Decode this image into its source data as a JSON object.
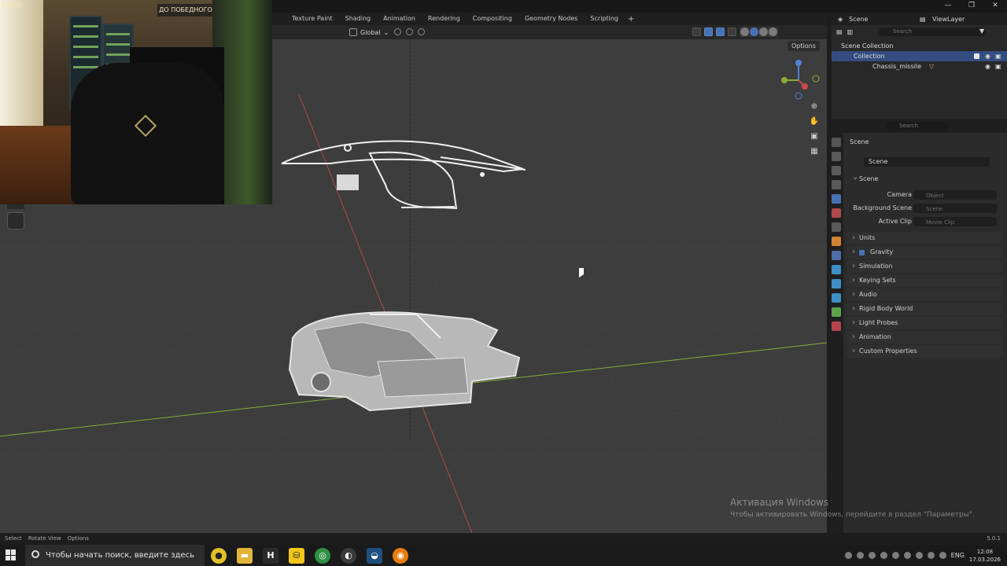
{
  "window": {
    "controls": [
      "—",
      "❐",
      "✕"
    ]
  },
  "workspace_tabs": [
    "Texture Paint",
    "Shading",
    "Animation",
    "Rendering",
    "Compositing",
    "Geometry Nodes",
    "Scripting"
  ],
  "header": {
    "transform_orientation": "Global"
  },
  "viewport": {
    "options_label": "Options",
    "grid_visible": true
  },
  "webcam": {
    "sign_text": "ДО ПОБЕДНОГО",
    "brand_text": "GOLD"
  },
  "outliner": {
    "scene_label": "Scene",
    "view_layer_label": "ViewLayer",
    "search_placeholder": "Search",
    "rows": {
      "scene_collection": "Scene Collection",
      "collection": "Collection",
      "object": "Chassis_missile"
    }
  },
  "properties": {
    "search_placeholder": "Search",
    "title": "Scene",
    "scene_field": "Scene",
    "section_scene": "Scene",
    "camera_label": "Camera",
    "camera_placeholder": "Object",
    "background_label": "Background Scene",
    "background_placeholder": "Scene",
    "clip_label": "Active Clip",
    "clip_placeholder": "Movie Clip",
    "sections": [
      "Units",
      "Gravity",
      "Simulation",
      "Keying Sets",
      "Audio",
      "Rigid Body World",
      "Light Probes",
      "Animation",
      "Custom Properties"
    ],
    "gravity_checked": true
  },
  "status_bar": {
    "select": "Select",
    "rotate": "Rotate View",
    "options": "Options",
    "version": "5.0.1"
  },
  "watermark": {
    "title": "Активация Windows",
    "subtitle": "Чтобы активировать Windows, перейдите в раздел \"Параметры\"."
  },
  "taskbar": {
    "search_placeholder": "Чтобы начать поиск, введите здесь запрос",
    "language": "ENG",
    "time": "12:08",
    "date": "17.03.2026"
  },
  "colors": {
    "accent": "#4772b3",
    "x_axis": "#b34a4a",
    "y_axis": "#8aad3b",
    "viewport_bg": "#3d3d3d"
  }
}
